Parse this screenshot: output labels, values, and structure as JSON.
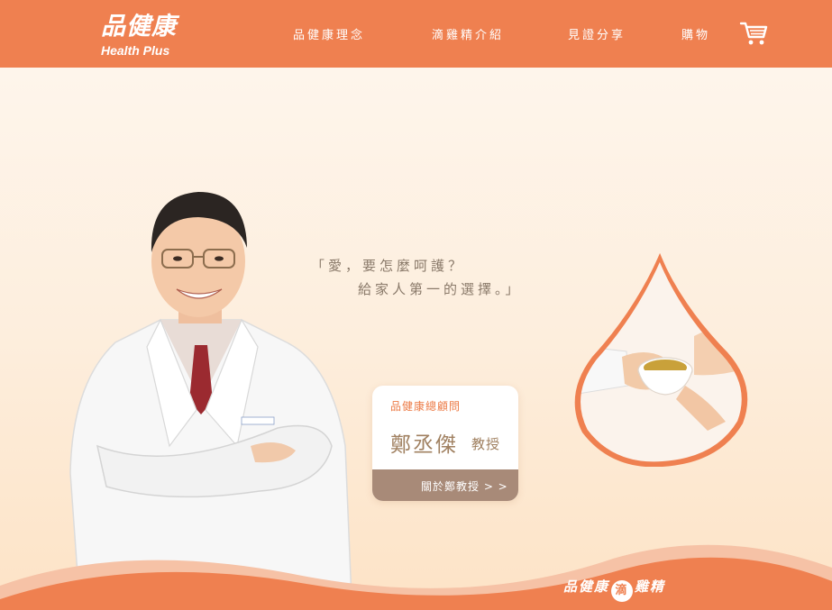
{
  "brand": {
    "name_cn": "品健康",
    "name_en": "Health Plus"
  },
  "nav": {
    "items": [
      {
        "label": "品健康理念"
      },
      {
        "label": "滴雞精介紹"
      },
      {
        "label": "見證分享"
      },
      {
        "label": "購物"
      }
    ],
    "cart_icon": "shopping-cart-icon"
  },
  "hero": {
    "quote_line1": "「愛，要怎麼呵護？",
    "quote_line2": "給家人第一的選擇。」"
  },
  "profile_card": {
    "role": "品健康總顧問",
    "name": "鄭丞傑",
    "title": "教授",
    "button_label": "關於鄭教授 > >"
  },
  "footer": {
    "brand_prefix": "品健康",
    "brand_badge": "滴",
    "brand_suffix": "雞精"
  },
  "colors": {
    "primary": "#ef8050",
    "background": "#fdeedd",
    "card_button": "#a88a78",
    "text_brown": "#a08060"
  }
}
